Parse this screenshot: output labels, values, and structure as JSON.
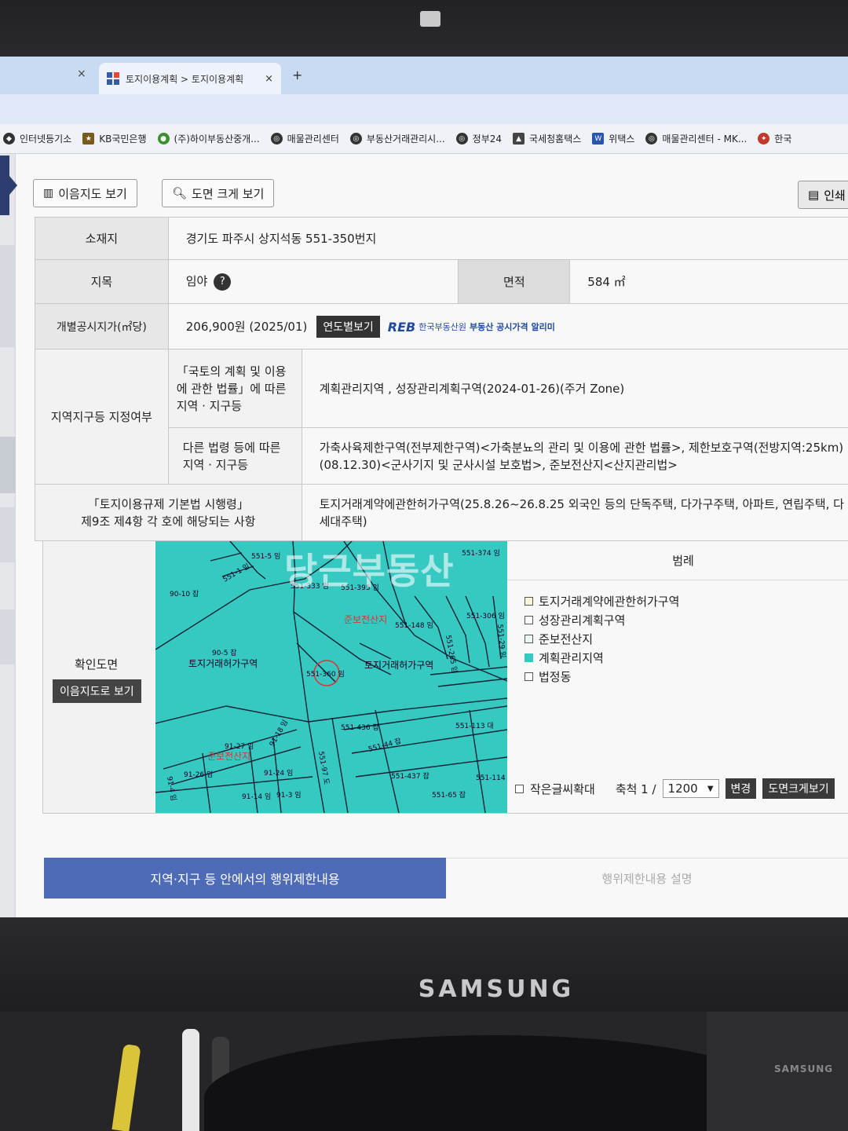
{
  "browser": {
    "tab_title": "토지이용계획 > 토지이용계획",
    "tab_close": "×",
    "prev_tab_close": "×",
    "new_tab": "+"
  },
  "bookmarks": [
    {
      "label": "인터넷등기소"
    },
    {
      "label": "KB국민은행"
    },
    {
      "label": "(주)하이부동산중개..."
    },
    {
      "label": "매물관리센터"
    },
    {
      "label": "부동산거래관리시..."
    },
    {
      "label": "정부24"
    },
    {
      "label": "국세청홈택스"
    },
    {
      "label": "위택스"
    },
    {
      "label": "매물관리센터 - MK..."
    },
    {
      "label": "한국"
    }
  ],
  "toolbar": {
    "land_map_btn": "이음지도 보기",
    "zoom_map_btn": "도면 크게 보기",
    "print_btn": "인쇄"
  },
  "info": {
    "location_label": "소재지",
    "location_value": "경기도 파주시 상지석동 551-350번지",
    "category_label": "지목",
    "category_value": "임야",
    "help_icon": "?",
    "area_label": "면적",
    "area_value": "584 ㎡",
    "price_label": "개별공시지가(㎡당)",
    "price_value": "206,900원 (2025/01)",
    "yearly_btn": "연도별보기",
    "reb_logo": "REB",
    "reb_org": "한국부동산원",
    "reb_service": "부동산 공시가격 알리미",
    "zoning_label": "지역지구등 지정여부",
    "national_law_label": "「국토의 계획 및 이용에 관한 법률」에 따른 지역 · 지구등",
    "national_law_value": "계획관리지역 , 성장관리계획구역(2024-01-26)(주거 Zone)",
    "other_law_label": "다른 법령 등에 따른 지역 · 지구등",
    "other_law_value": "가축사육제한구역(전부제한구역)<가축분뇨의 관리 및 이용에 관한 법률>, 제한보호구역(전방지역:25km)(08.12.30)<군사기지 및 군사시설 보호법>, 준보전산지<산지관리법>",
    "enforcement_label_1": "「토지이용규제 기본법 시행령」",
    "enforcement_label_2": "제9조 제4항 각 호에 해당되는 사항",
    "enforcement_value": "토지거래계약에관한허가구역(25.8.26~26.8.25 외국인 등의 단독주택, 다가구주택, 아파트, 연립주택, 다세대주택)"
  },
  "map": {
    "section_label": "확인도면",
    "view_btn": "이음지도로 보기",
    "watermark": "당근부동산",
    "parcels": [
      "551-5 임",
      "551-1 임",
      "90-10 잡",
      "551-333 임",
      "551-395 임",
      "551-374 임",
      "551-148 임",
      "551-306 임",
      "551-265 임",
      "551-29 임",
      "90-5 잡",
      "551-360 임",
      "551-436 잡",
      "551-44 잡",
      "551-113 대",
      "91-27 임",
      "91-18 임",
      "91-26 임",
      "91-24 임",
      "91-4 임",
      "91-14 임",
      "91-3 임",
      "551-97 도",
      "551-437 잡",
      "551-114 대",
      "551-65 잡"
    ],
    "zone_labels": [
      "토지거래허가구역",
      "토지거래허가구역"
    ],
    "reserve_labels": [
      "준보전산지",
      "준보전산지"
    ]
  },
  "legend": {
    "title": "범례",
    "items": [
      {
        "label": "토지거래계약에관한허가구역",
        "color": "#fdf5d8"
      },
      {
        "label": "성장관리계획구역",
        "color": "#ffffff"
      },
      {
        "label": "준보전산지",
        "color": "#e8fbf3"
      },
      {
        "label": "계획관리지역",
        "color": "#36c9c2"
      },
      {
        "label": "법정동",
        "color": "#ffffff"
      }
    ],
    "small_text_zoom": "작은글씨확대",
    "scale_label": "축척 1 /",
    "scale_value": "1200",
    "change_btn": "변경",
    "zoom_btn": "도면크게보기"
  },
  "restrict": {
    "active_tab": "지역·지구 등 안에서의 행위제한내용",
    "inactive_tab": "행위제한내용 설명"
  },
  "monitor": {
    "brand": "SAMSUNG",
    "box_brand": "SAMSUNG"
  },
  "colors": {
    "map_zone": "#36c9c2",
    "active_tab": "#4e6bb8",
    "header_bg": "#e7e7e7"
  }
}
